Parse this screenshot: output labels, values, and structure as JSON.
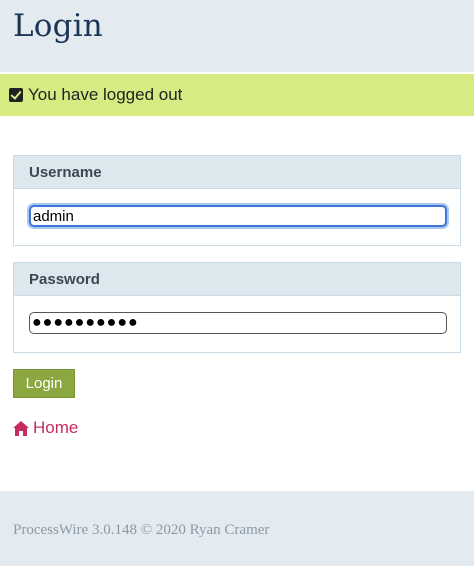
{
  "header": {
    "title": "Login"
  },
  "notice": {
    "message": "You have logged out",
    "icon": "check-square-icon"
  },
  "form": {
    "username": {
      "label": "Username",
      "value": "admin"
    },
    "password": {
      "label": "Password",
      "value": "●●●●●●●●●●"
    },
    "submit_label": "Login"
  },
  "links": {
    "home_label": "Home",
    "home_icon": "home-icon"
  },
  "footer": {
    "text": "ProcessWire 3.0.148 © 2020 Ryan Cramer"
  },
  "colors": {
    "masthead_bg": "#e4ebf0",
    "title": "#1b3654",
    "notice_bg": "#d7eb83",
    "button_bg": "#8aa83f",
    "link": "#c72c5f",
    "footer_text": "#8b9aa7"
  }
}
